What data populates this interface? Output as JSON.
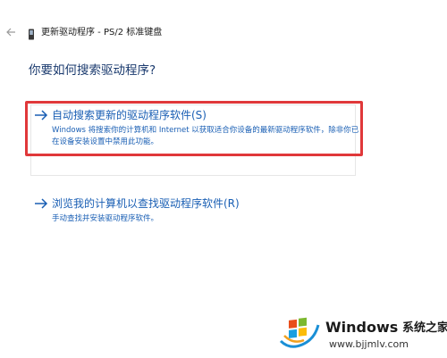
{
  "window": {
    "title": "更新驱动程序 - PS/2 标准键盘"
  },
  "page": {
    "heading": "你要如何搜索驱动程序?"
  },
  "options": [
    {
      "title": "自动搜索更新的驱动程序软件(S)",
      "description": "Windows 将搜索你的计算机和 Internet 以获取适合你设备的最新驱动程序软件，除非你已在设备安装设置中禁用此功能。"
    },
    {
      "title": "浏览我的计算机以查找驱动程序软件(R)",
      "description": "手动查找并安装驱动程序软件。"
    }
  ],
  "watermark": {
    "brand": "Windows",
    "brand_cn": "系统之家",
    "url": "www.bjjmlv.com"
  },
  "colors": {
    "link": "#1a5fb4",
    "highlight": "#e0383a"
  },
  "icons": {
    "back": "back-arrow-icon",
    "device": "keyboard-device-icon",
    "option": "arrow-right-icon"
  }
}
